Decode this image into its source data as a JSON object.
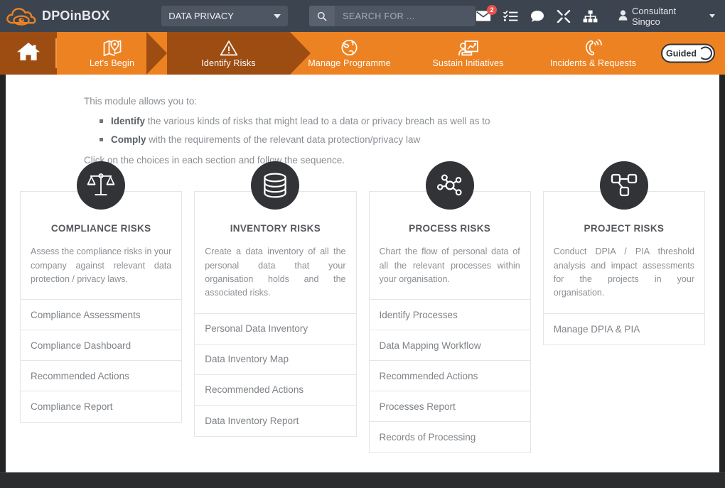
{
  "topbar": {
    "brand_name": "DPOinBOX",
    "brand_logo_icon": "cloud-eye-logo",
    "module_select": {
      "value": "DATA PRIVACY",
      "caret_icon": "chevron-down-icon"
    },
    "search": {
      "placeholder": "SEARCH FOR ...",
      "value": "",
      "icon": "search-icon"
    },
    "icons": [
      {
        "name": "envelope-icon",
        "badge": "2"
      },
      {
        "name": "task-list-icon",
        "badge": ""
      },
      {
        "name": "chat-bubble-icon",
        "badge": ""
      },
      {
        "name": "tools-icon",
        "badge": ""
      },
      {
        "name": "sitemap-icon",
        "badge": ""
      }
    ],
    "user": {
      "name": "Consultant Singco",
      "avatar_icon": "user-avatar-icon",
      "caret_icon": "caret-down-icon"
    }
  },
  "nav": {
    "home_icon": "home-icon",
    "items": [
      {
        "label": "Let's Begin",
        "icon": "map-pin-icon",
        "active": false
      },
      {
        "label": "Identify Risks",
        "icon": "warning-triangle-icon",
        "active": true
      },
      {
        "label": "Manage Programme",
        "icon": "globe-icon",
        "active": false
      },
      {
        "label": "Sustain Initiatives",
        "icon": "user-presentation-icon",
        "active": false
      },
      {
        "label": "Incidents & Requests",
        "icon": "phone-ring-icon",
        "active": false
      }
    ],
    "guided_toggle": {
      "label": "Guided",
      "state": "on"
    }
  },
  "intro": {
    "lead": "This module allows you to:",
    "bullets": [
      {
        "bold": "Identify",
        "rest": " the various kinds of risks that might lead to a data or privacy breach as well as to"
      },
      {
        "bold": "Comply",
        "rest": " with the requirements of the relevant data protection/privacy law"
      }
    ],
    "tail": "Click on the choices in each section and follow the sequence."
  },
  "cards": [
    {
      "icon": "balance-scale-icon",
      "title": "COMPLIANCE RISKS",
      "description": "Assess the compliance risks in your company against relevant data protection / privacy laws.",
      "items": [
        "Compliance Assessments",
        "Compliance Dashboard",
        "Recommended Actions",
        "Compliance Report"
      ]
    },
    {
      "icon": "database-icon",
      "title": "INVENTORY RISKS",
      "description": "Create a data inventory of all the personal data that your organisation holds and the associated risks.",
      "items": [
        "Personal Data Inventory",
        "Data Inventory Map",
        "Recommended Actions",
        "Data Inventory Report"
      ]
    },
    {
      "icon": "network-nodes-icon",
      "title": "PROCESS RISKS",
      "description": "Chart the flow of personal data of all the relevant processes within your organisation.",
      "items": [
        "Identify Processes",
        "Data Mapping Workflow",
        "Recommended Actions",
        "Processes Report",
        "Records of Processing"
      ]
    },
    {
      "icon": "project-nodes-icon",
      "title": "PROJECT RISKS",
      "description": "Conduct DPIA / PIA threshold analysis and impact assessments for the projects in your organisation.",
      "items": [
        "Manage DPIA & PIA"
      ]
    }
  ],
  "colors": {
    "topbar_bg": "#3c4450",
    "nav_bg": "#ed8222",
    "nav_active_bg": "#9d4d12",
    "card_icon_bg": "#313336",
    "badge_red": "#e8524b"
  }
}
